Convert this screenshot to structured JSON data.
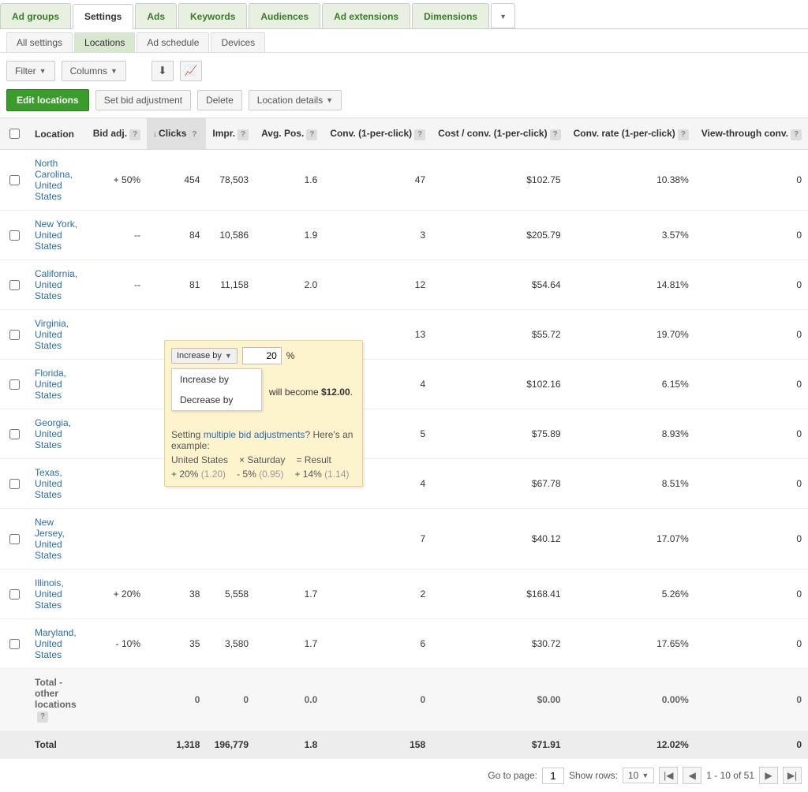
{
  "main_tabs": [
    "Ad groups",
    "Settings",
    "Ads",
    "Keywords",
    "Audiences",
    "Ad extensions",
    "Dimensions"
  ],
  "main_active": "Settings",
  "sub_tabs": [
    "All settings",
    "Locations",
    "Ad schedule",
    "Devices"
  ],
  "sub_active": "Locations",
  "toolbar": {
    "filter": "Filter",
    "columns": "Columns"
  },
  "actions": {
    "edit": "Edit locations",
    "setbid": "Set bid adjustment",
    "delete": "Delete",
    "locdetails": "Location details"
  },
  "columns": {
    "location": "Location",
    "bidadj": "Bid adj.",
    "clicks": "Clicks",
    "impr": "Impr.",
    "avgpos": "Avg. Pos.",
    "conv": "Conv. (1-per-click)",
    "costconv": "Cost / conv. (1-per-click)",
    "convrate": "Conv. rate (1-per-click)",
    "viewthru": "View-through conv."
  },
  "rows": [
    {
      "location": "North Carolina, United States",
      "bidadj": "+ 50%",
      "clicks": "454",
      "impr": "78,503",
      "avgpos": "1.6",
      "conv": "47",
      "costconv": "$102.75",
      "convrate": "10.38%",
      "viewthru": "0"
    },
    {
      "location": "New York, United States",
      "bidadj": "--",
      "clicks": "84",
      "impr": "10,586",
      "avgpos": "1.9",
      "conv": "3",
      "costconv": "$205.79",
      "convrate": "3.57%",
      "viewthru": "0"
    },
    {
      "location": "California, United States",
      "bidadj": "--",
      "clicks": "81",
      "impr": "11,158",
      "avgpos": "2.0",
      "conv": "12",
      "costconv": "$54.64",
      "convrate": "14.81%",
      "viewthru": "0"
    },
    {
      "location": "Virginia, United States",
      "bidadj": "",
      "clicks": "",
      "impr": "",
      "avgpos": "",
      "conv": "13",
      "costconv": "$55.72",
      "convrate": "19.70%",
      "viewthru": "0"
    },
    {
      "location": "Florida, United States",
      "bidadj": "",
      "clicks": "",
      "impr": "",
      "avgpos": "",
      "conv": "4",
      "costconv": "$102.16",
      "convrate": "6.15%",
      "viewthru": "0"
    },
    {
      "location": "Georgia, United States",
      "bidadj": "",
      "clicks": "",
      "impr": "",
      "avgpos": "",
      "conv": "5",
      "costconv": "$75.89",
      "convrate": "8.93%",
      "viewthru": "0"
    },
    {
      "location": "Texas, United States",
      "bidadj": "",
      "clicks": "",
      "impr": "",
      "avgpos": "",
      "conv": "4",
      "costconv": "$67.78",
      "convrate": "8.51%",
      "viewthru": "0"
    },
    {
      "location": "New Jersey, United States",
      "bidadj": "",
      "clicks": "",
      "impr": "",
      "avgpos": "",
      "conv": "7",
      "costconv": "$40.12",
      "convrate": "17.07%",
      "viewthru": "0"
    },
    {
      "location": "Illinois, United States",
      "bidadj": "+ 20%",
      "clicks": "38",
      "impr": "5,558",
      "avgpos": "1.7",
      "conv": "2",
      "costconv": "$168.41",
      "convrate": "5.26%",
      "viewthru": "0"
    },
    {
      "location": "Maryland, United States",
      "bidadj": "- 10%",
      "clicks": "35",
      "impr": "3,580",
      "avgpos": "1.7",
      "conv": "6",
      "costconv": "$30.72",
      "convrate": "17.65%",
      "viewthru": "0"
    }
  ],
  "other_total": {
    "label": "Total - other locations",
    "clicks": "0",
    "impr": "0",
    "avgpos": "0.0",
    "conv": "0",
    "costconv": "$0.00",
    "convrate": "0.00%",
    "viewthru": "0"
  },
  "grand_total": {
    "label": "Total",
    "clicks": "1,318",
    "impr": "196,779",
    "avgpos": "1.8",
    "conv": "158",
    "costconv": "$71.91",
    "convrate": "12.02%",
    "viewthru": "0"
  },
  "popup": {
    "select_label": "Increase by",
    "value": "20",
    "unit": "%",
    "option1": "Increase by",
    "option2": "Decrease by",
    "outcome_prefix": "will become ",
    "outcome_value": "$12.00",
    "outcome_suffix": ".",
    "hint_prefix": "Setting ",
    "hint_link": "multiple bid adjustments",
    "hint_suffix": "? Here's an example:",
    "ex1_label": "United States",
    "ex1_val": "+ 20%",
    "ex1_mult": "(1.20)",
    "ex_op": "×",
    "ex2_label": "Saturday",
    "ex2_val": "- 5%",
    "ex2_mult": "(0.95)",
    "ex_eq": "= Result",
    "ex3_val": "+ 14%",
    "ex3_mult": "(1.14)"
  },
  "pager": {
    "goto": "Go to page:",
    "page": "1",
    "showrows": "Show rows:",
    "rows": "10",
    "range": "1 - 10 of 51"
  }
}
